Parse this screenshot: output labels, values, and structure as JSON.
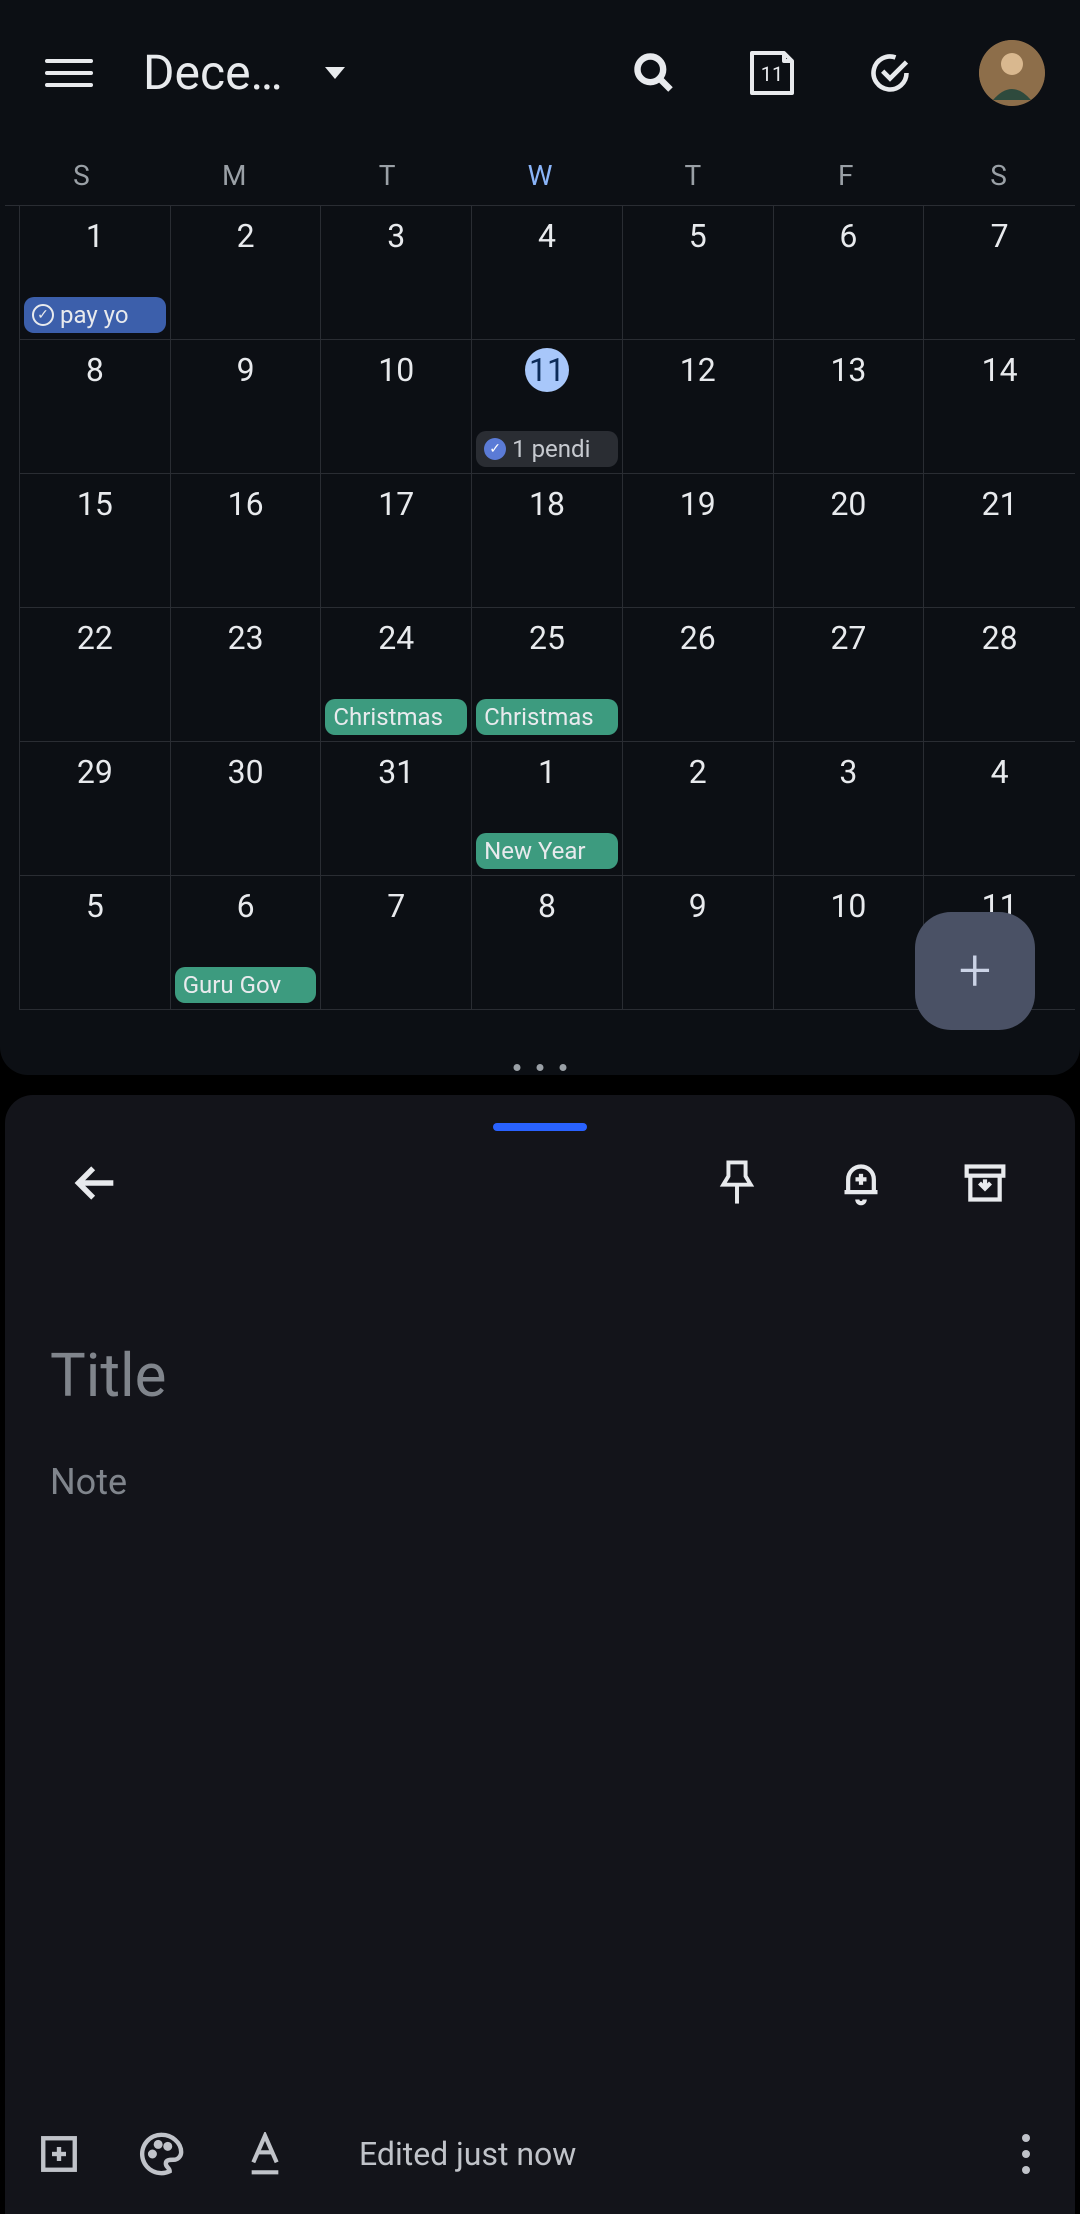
{
  "calendar": {
    "month_label": "Dece…",
    "today_date_icon": "11",
    "weekdays": [
      "S",
      "M",
      "T",
      "W",
      "T",
      "F",
      "S"
    ],
    "today_column_index": 3,
    "weeks": [
      [
        {
          "n": "1",
          "chip": {
            "type": "task",
            "text": "pay yo"
          }
        },
        {
          "n": "2"
        },
        {
          "n": "3"
        },
        {
          "n": "4"
        },
        {
          "n": "5"
        },
        {
          "n": "6"
        },
        {
          "n": "7"
        }
      ],
      [
        {
          "n": "8"
        },
        {
          "n": "9"
        },
        {
          "n": "10"
        },
        {
          "n": "11",
          "today": true,
          "chip": {
            "type": "pending",
            "text": "1 pendi"
          }
        },
        {
          "n": "12"
        },
        {
          "n": "13"
        },
        {
          "n": "14"
        }
      ],
      [
        {
          "n": "15"
        },
        {
          "n": "16"
        },
        {
          "n": "17"
        },
        {
          "n": "18"
        },
        {
          "n": "19"
        },
        {
          "n": "20"
        },
        {
          "n": "21"
        }
      ],
      [
        {
          "n": "22"
        },
        {
          "n": "23"
        },
        {
          "n": "24",
          "chip": {
            "type": "holiday",
            "text": "Christmas"
          }
        },
        {
          "n": "25",
          "chip": {
            "type": "holiday",
            "text": "Christmas"
          }
        },
        {
          "n": "26"
        },
        {
          "n": "27"
        },
        {
          "n": "28"
        }
      ],
      [
        {
          "n": "29"
        },
        {
          "n": "30"
        },
        {
          "n": "31"
        },
        {
          "n": "1",
          "chip": {
            "type": "holiday",
            "text": "New Year"
          }
        },
        {
          "n": "2"
        },
        {
          "n": "3"
        },
        {
          "n": "4"
        }
      ],
      [
        {
          "n": "5"
        },
        {
          "n": "6",
          "chip": {
            "type": "holiday",
            "text": "Guru Gov"
          }
        },
        {
          "n": "7"
        },
        {
          "n": "8"
        },
        {
          "n": "9"
        },
        {
          "n": "10"
        },
        {
          "n": "11"
        }
      ]
    ],
    "fab_label": "+"
  },
  "notes": {
    "title_placeholder": "Title",
    "body_placeholder": "Note",
    "edited_label": "Edited just now"
  }
}
